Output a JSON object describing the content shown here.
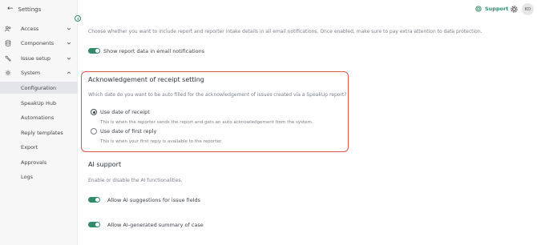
{
  "sidebar": {
    "back_label": "Settings",
    "items": [
      {
        "label": "Access",
        "icon": "users-icon"
      },
      {
        "label": "Components",
        "icon": "database-icon"
      },
      {
        "label": "Issue setup",
        "icon": "wrench-icon"
      },
      {
        "label": "System",
        "icon": "gear-icon"
      }
    ],
    "sub_items": [
      {
        "label": "Configuration",
        "active": true
      },
      {
        "label": "SpeakUp Hub"
      },
      {
        "label": "Automations"
      },
      {
        "label": "Reply templates"
      },
      {
        "label": "Export"
      },
      {
        "label": "Approvals"
      },
      {
        "label": "Logs"
      }
    ]
  },
  "topbar": {
    "support_label": "Support",
    "avatar_initials": "KD"
  },
  "main": {
    "report_intake_desc": "Choose whether you want to include report and reporter intake details in all email notifications. Once enabled, make sure to pay extra attention to data protection.",
    "show_report_toggle_label": "Show report data in email notifications",
    "acknowledgement": {
      "title": "Acknowledgement of receipt setting",
      "description": "Which date do you want to be auto filled for the acknowledgement of issues created via a SpeakUp report?",
      "options": [
        {
          "label": "Use date of receipt",
          "help": "This is when the reporter sends the report and gets an auto acknowledgement from the system.",
          "checked": true
        },
        {
          "label": "Use date of first reply",
          "help": "This is when your first reply is available to the reporter.",
          "checked": false
        }
      ]
    },
    "ai_support": {
      "title": "AI support",
      "description": "Enable or disable the AI functionalities.",
      "toggles": [
        {
          "label": "Allow AI suggestions for issue fields",
          "on": true
        },
        {
          "label": "Allow AI-generated summary of case",
          "on": true
        }
      ]
    }
  },
  "colors": {
    "accent": "#2f8b6a",
    "highlight_border": "#e0554f"
  }
}
